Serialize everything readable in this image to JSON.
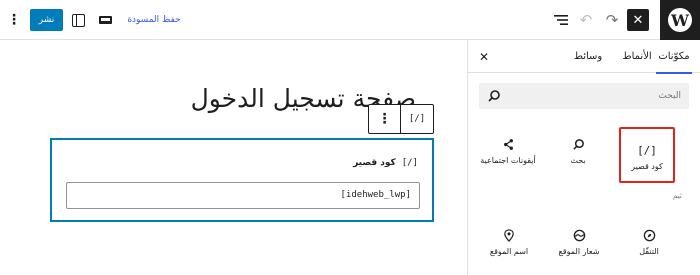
{
  "toolbar": {
    "publish_label": "نشر",
    "save_draft_label": "حفظ المسودة",
    "options_glyph": "⋮",
    "undo_glyph": "↶",
    "redo_glyph": "↷",
    "close_glyph": "✕",
    "wp_logo_letter": "W"
  },
  "inserter": {
    "tabs": {
      "blocks": "مكوّنات",
      "patterns": "الأنماط",
      "media": "وسائط"
    },
    "close_glyph": "✕",
    "search_placeholder": "البحث",
    "blocks": [
      {
        "label": "كود قصير",
        "icon": "[/]"
      },
      {
        "label": "بحث",
        "icon": "search-icon"
      },
      {
        "label": "أيقونات اجتماعية",
        "icon": "share-icon"
      }
    ],
    "section_label": "ثيم",
    "theme_blocks": [
      {
        "label": "التنقّل",
        "icon": "compass-icon"
      },
      {
        "label": "شعار الموقع",
        "icon": "site-logo-icon"
      },
      {
        "label": "اسم الموقع",
        "icon": "map-pin-icon"
      }
    ]
  },
  "editor": {
    "page_title": "صفحة تسجيل الدخول",
    "block_toolbar": {
      "type_icon": "[/]",
      "more_glyph": "⋮"
    },
    "shortcode_block": {
      "label": "كود قصير",
      "icon": "[/]",
      "value": "[idehweb_lwp]"
    }
  },
  "colors": {
    "accent": "#3858e9",
    "publish": "#007cba",
    "highlight": "#e2231a"
  }
}
